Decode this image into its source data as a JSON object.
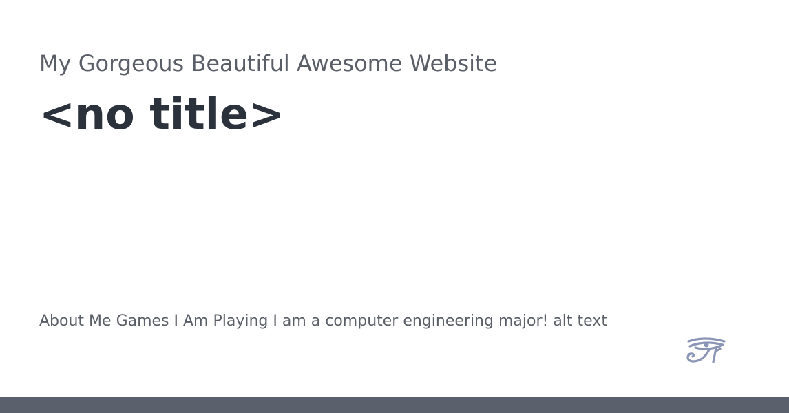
{
  "header": {
    "site_name": "My Gorgeous Beautiful Awesome Website",
    "page_title": "<no title>"
  },
  "content": {
    "about_link": "About Me",
    "games_link": "Games I Am Playing",
    "bio_text": "I am a computer engineering major!",
    "image_alt": "alt text"
  },
  "logo": {
    "icon": "eye-of-horus-icon",
    "color": "#8a95b5"
  },
  "colors": {
    "text": "#5a5e66",
    "title": "#2b323b",
    "footer": "#5b616c"
  }
}
